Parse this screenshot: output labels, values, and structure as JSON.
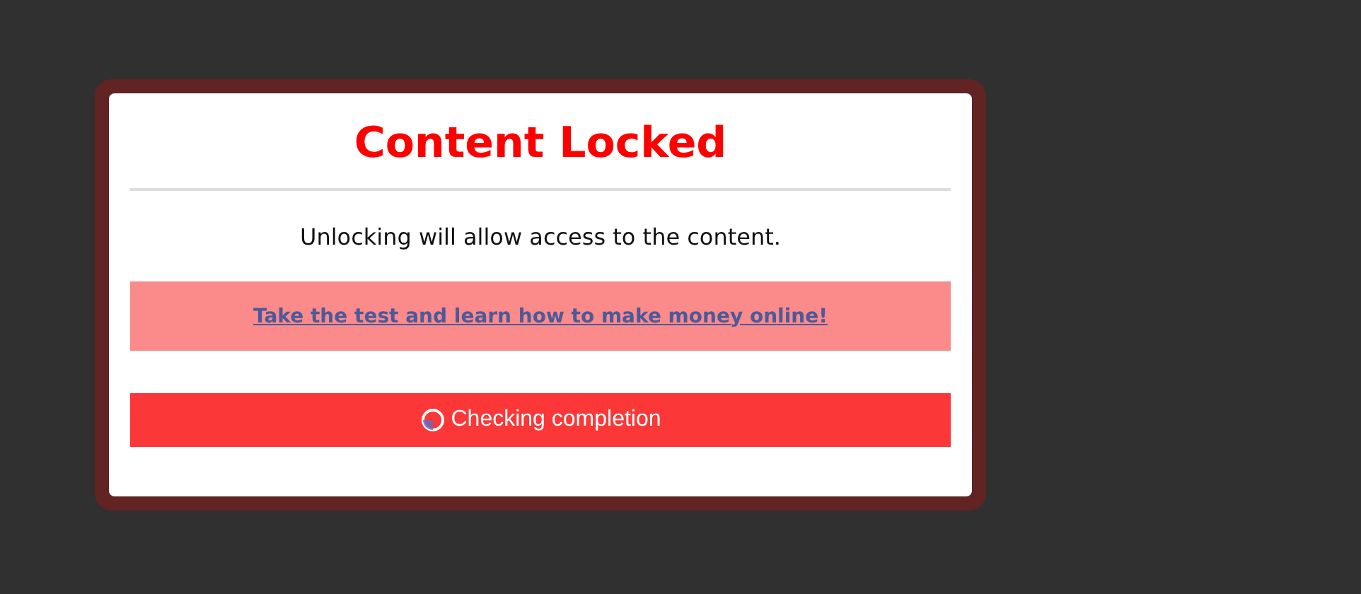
{
  "dialog": {
    "title": "Content Locked",
    "message": "Unlocking will allow access to the content.",
    "offer": {
      "link": "Take the test and learn how to make money online!"
    },
    "button": {
      "label": "Checking completion",
      "loading": true
    }
  }
}
